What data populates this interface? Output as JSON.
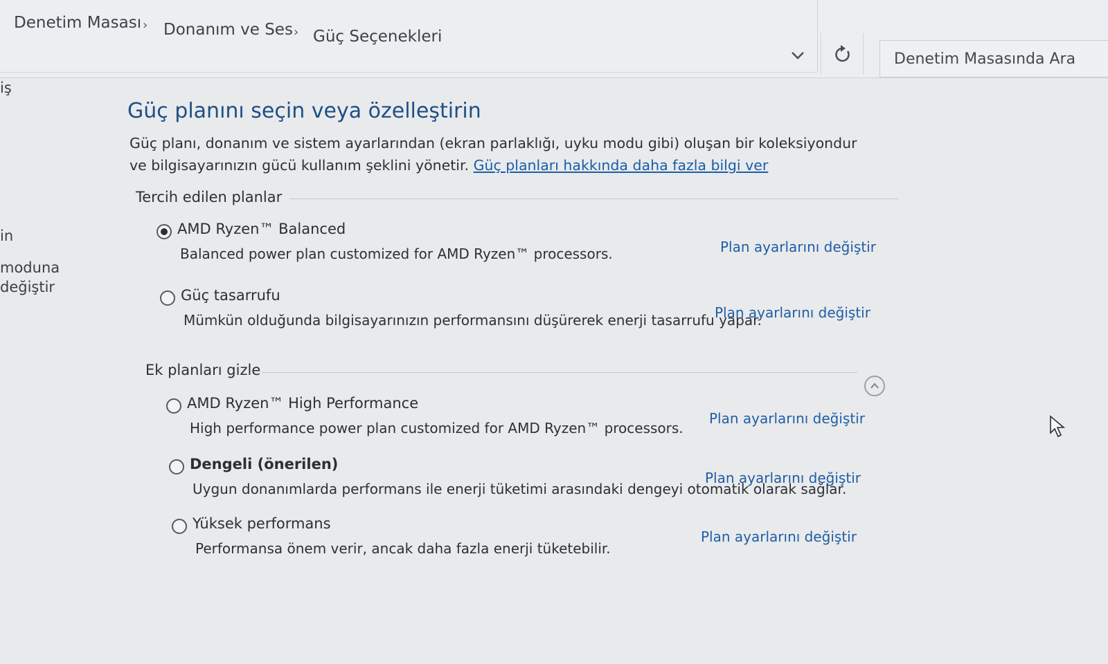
{
  "breadcrumb": {
    "items": [
      "Denetim Masası",
      "Donanım ve Ses",
      "Güç Seçenekleri"
    ]
  },
  "search": {
    "placeholder": "Denetim Masasında Ara"
  },
  "left_nav": {
    "items": [
      "iş",
      "in",
      "moduna",
      "değiştir"
    ]
  },
  "main": {
    "title": "Güç planını seçin veya özelleştirin",
    "description": "Güç planı, donanım ve sistem ayarlarından (ekran parlaklığı, uyku modu gibi) oluşan bir koleksiyondur ve bilgisayarınızın gücü kullanım şeklini yönetir.",
    "learn_more_link": "Güç planları hakkında daha fazla bilgi ver",
    "preferred_header": "Tercih edilen planlar",
    "additional_header": "Ek planları gizle",
    "change_link_label": "Plan ayarlarını değiştir",
    "preferred_plans": [
      {
        "name": "AMD Ryzen™ Balanced",
        "description": "Balanced power plan customized for AMD Ryzen™ processors.",
        "selected": true
      },
      {
        "name": "Güç tasarrufu",
        "description": "Mümkün olduğunda bilgisayarınızın performansını düşürerek enerji tasarrufu yapar.",
        "selected": false
      }
    ],
    "additional_plans": [
      {
        "name": "AMD Ryzen™ High Performance",
        "description": "High performance power plan customized for AMD Ryzen™ processors.",
        "selected": false
      },
      {
        "name": "Dengeli (önerilen)",
        "description": "Uygun donanımlarda performans ile enerji tüketimi arasındaki dengeyi otomatik olarak sağlar.",
        "selected": false
      },
      {
        "name": "Yüksek performans",
        "description": "Performansa önem verir, ancak daha fazla enerji tüketebilir.",
        "selected": false
      }
    ]
  },
  "colors": {
    "title": "#1f4f86",
    "link": "#1e5ea6",
    "background": "#e9eaec"
  }
}
